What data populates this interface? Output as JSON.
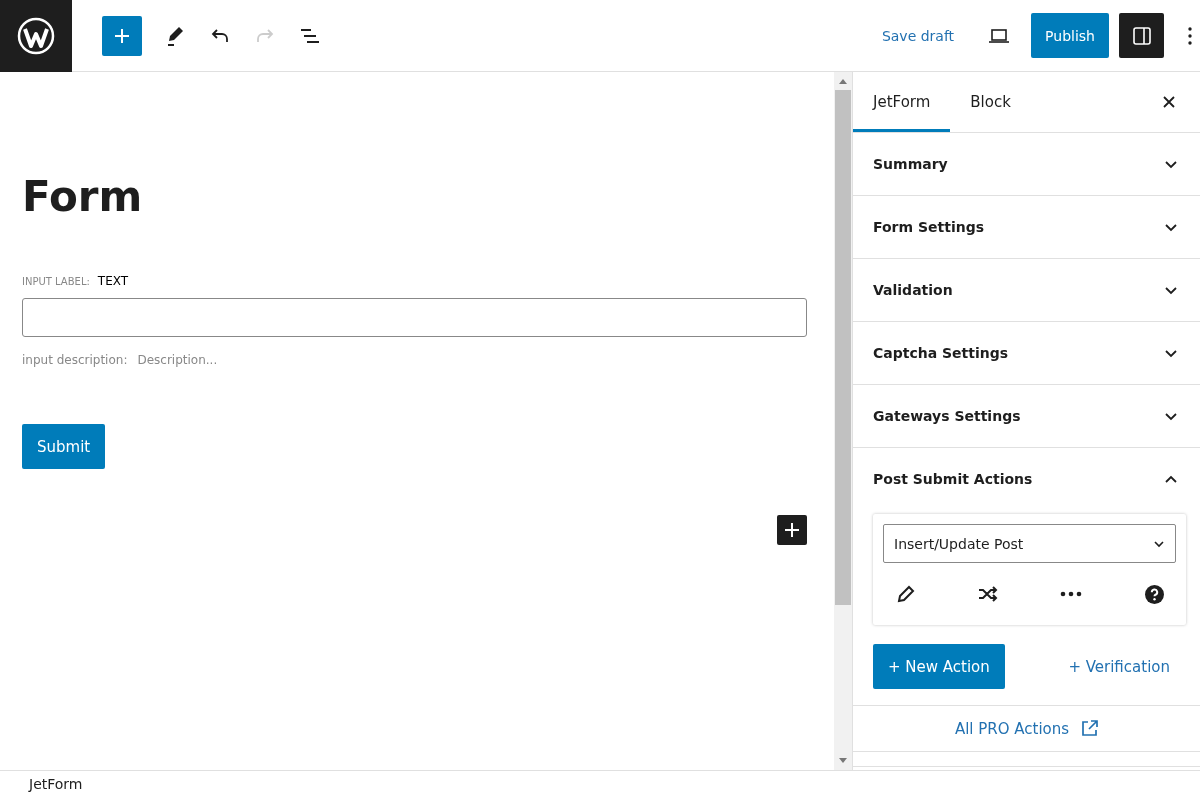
{
  "header": {
    "undo_disabled": false,
    "redo_disabled": true,
    "save_draft": "Save draft",
    "publish": "Publish",
    "settings_open": true
  },
  "editor": {
    "title": "Form",
    "field_label_caption": "INPUT LABEL:",
    "field_label": "TEXT",
    "description_caption": "input description:",
    "description_placeholder": "Description...",
    "submit": "Submit"
  },
  "sidebar": {
    "tabs": [
      {
        "label": "JetForm",
        "selected": true
      },
      {
        "label": "Block",
        "selected": false
      }
    ],
    "panels": [
      {
        "title": "Summary",
        "expanded": false
      },
      {
        "title": "Form Settings",
        "expanded": false
      },
      {
        "title": "Validation",
        "expanded": false
      },
      {
        "title": "Captcha Settings",
        "expanded": false
      },
      {
        "title": "Gateways Settings",
        "expanded": false
      },
      {
        "title": "Post Submit Actions",
        "expanded": true
      }
    ],
    "action": {
      "type": "Insert/Update Post"
    },
    "new_action": "+ New Action",
    "verification": "+ Verification",
    "pro_link": "All PRO Actions"
  },
  "footer": {
    "breadcrumb": "JetForm"
  }
}
